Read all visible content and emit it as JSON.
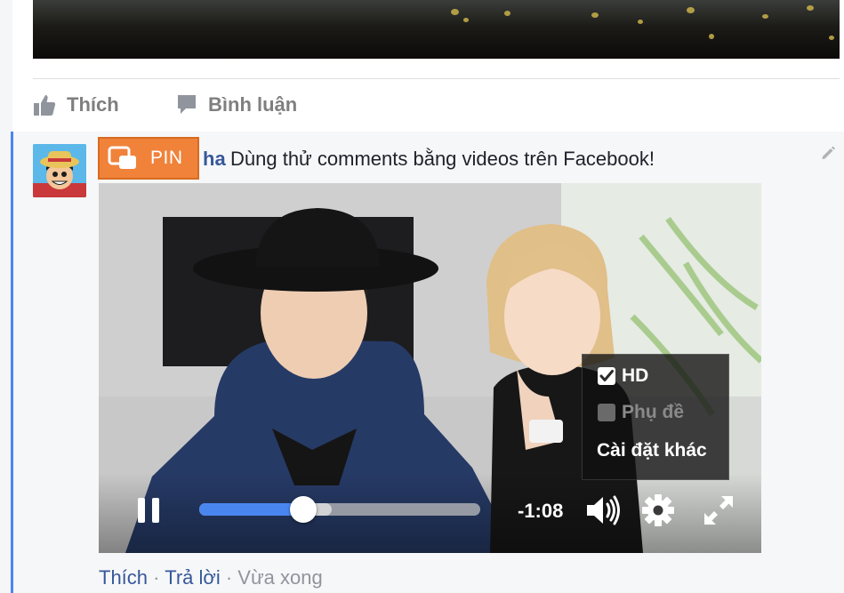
{
  "post_actions": {
    "like_label": "Thích",
    "comment_label": "Bình luận"
  },
  "comment": {
    "author_name": "ha",
    "text": "Dùng thử comments bằng videos trên Facebook!",
    "pin_button_label": "PIN",
    "actions": {
      "like": "Thích",
      "separator": "·",
      "reply": "Trả lời",
      "timestamp": "Vừa xong"
    }
  },
  "video": {
    "time_remaining": "-1:08",
    "progress_fraction": 0.37,
    "buffered_fraction": 0.47,
    "settings_menu": {
      "items": [
        {
          "label": "HD",
          "checked": true,
          "enabled": true
        },
        {
          "label": "Phụ đề",
          "checked": false,
          "enabled": false
        }
      ],
      "more_settings_label": "Cài đặt khác"
    },
    "icons": [
      "pause-icon",
      "volume-icon",
      "settings-gear-icon",
      "fullscreen-icon"
    ]
  },
  "colors": {
    "accent_blue": "#4a86f0",
    "link_blue": "#365899",
    "pin_orange": "#f0823a"
  }
}
